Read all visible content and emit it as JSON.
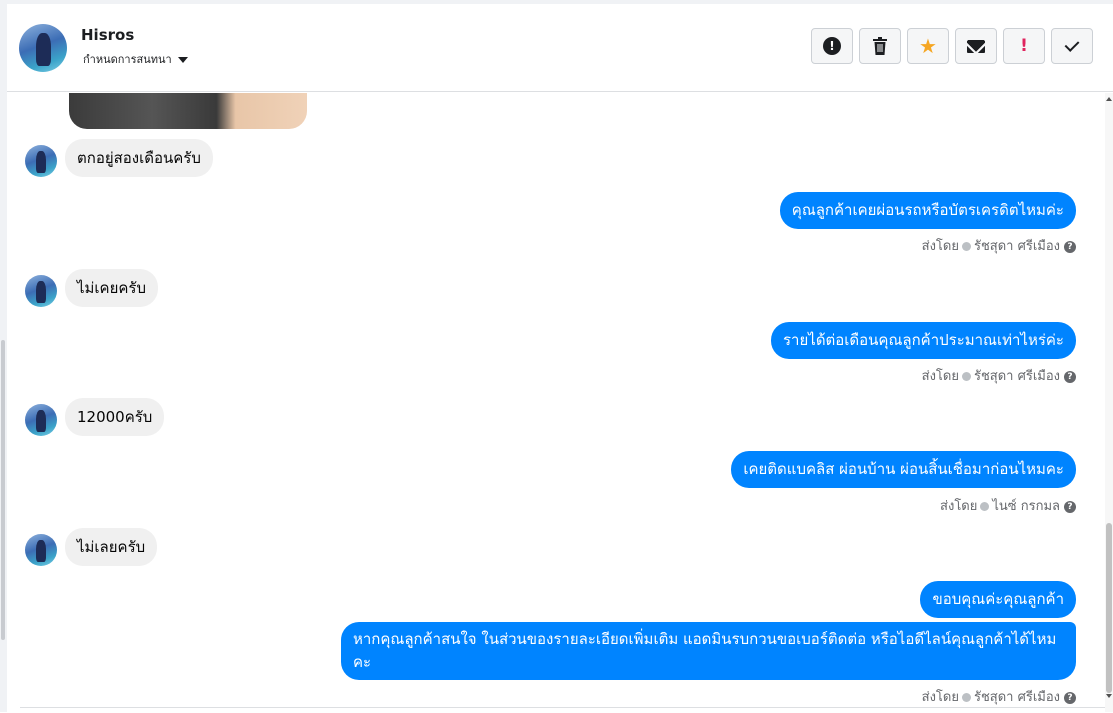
{
  "header": {
    "contact_name": "Hisros",
    "assign_label": "กำหนดการสนทนา"
  },
  "toolbar": {
    "buttons": [
      {
        "name": "report-spam",
        "icon": "warning-circle-icon"
      },
      {
        "name": "delete",
        "icon": "trash-icon"
      },
      {
        "name": "star",
        "icon": "star-icon",
        "color": "#f5a623"
      },
      {
        "name": "mark-unread",
        "icon": "envelope-icon"
      },
      {
        "name": "follow-up",
        "icon": "exclamation-icon",
        "color": "#e0245e"
      },
      {
        "name": "mark-done",
        "icon": "checkmark-icon"
      }
    ]
  },
  "messages": [
    {
      "direction": "in",
      "text": "ตกอยู่สองเดือนครับ"
    },
    {
      "direction": "out",
      "text": "คุณลูกค้าเคยผ่อนรถหรือบัตรเครดิตไหมค่ะ",
      "sent_by_label": "ส่งโดย",
      "sender": "รัชสุดา ศรีเมือง"
    },
    {
      "direction": "in",
      "text": "ไม่เคยครับ"
    },
    {
      "direction": "out",
      "text": "รายได้ต่อเดือนคุณลูกค้าประมาณเท่าไหร่ค่ะ",
      "sent_by_label": "ส่งโดย",
      "sender": "รัชสุดา ศรีเมือง"
    },
    {
      "direction": "in",
      "text": "12000ครับ"
    },
    {
      "direction": "out",
      "text": "เคยติดแบคลิส ผ่อนบ้าน ผ่อนสิ้นเชื่อมาก่อนไหมคะ",
      "sent_by_label": "ส่งโดย",
      "sender": "ไนซ์ กรกมล"
    },
    {
      "direction": "in",
      "text": "ไม่เลยครับ"
    },
    {
      "direction": "out",
      "text": "ขอบคุณค่ะคุณลูกค้า"
    },
    {
      "direction": "out",
      "text": "หากคุณลูกค้าสนใจ ในส่วนของรายละเอียดเพิ่มเติม แอดมินรบกวนขอเบอร์ติดต่อ หรือไอดีไลน์คุณลูกค้าได้ไหมคะ",
      "sent_by_label": "ส่งโดย",
      "sender": "รัชสุดา ศรีเมือง"
    }
  ],
  "colors": {
    "outgoing_bubble": "#0084ff",
    "incoming_bubble": "#f0f0f0",
    "meta_text": "#65676b"
  }
}
